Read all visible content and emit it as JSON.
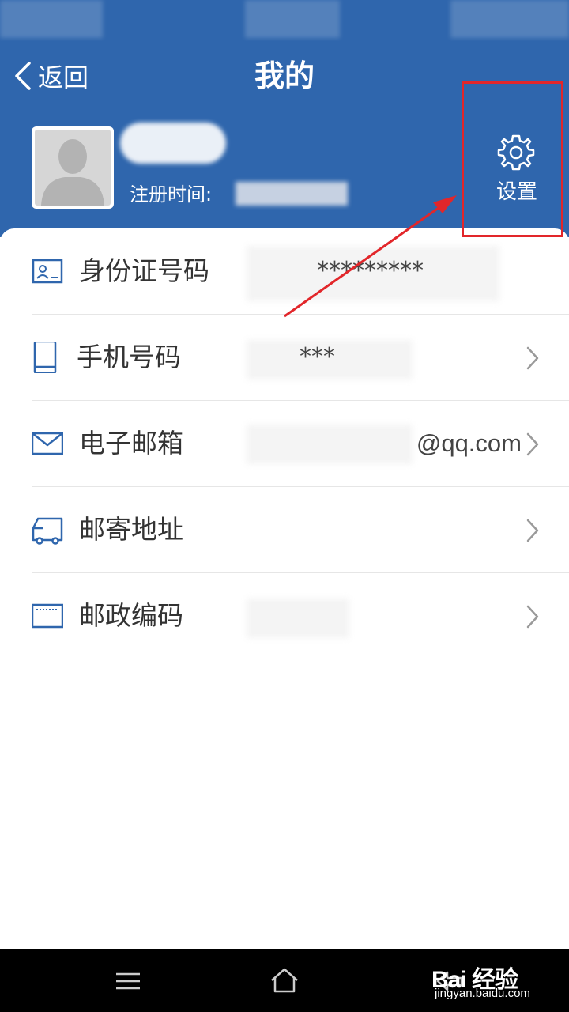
{
  "header": {
    "back_label": "返回",
    "title": "我的",
    "reg_time_label": "注册时间:",
    "settings_label": "设置"
  },
  "rows": [
    {
      "label": "身份证号码",
      "value": "*********",
      "icon": "id-card-icon",
      "has_chevron": false
    },
    {
      "label": "手机号码",
      "value": "***",
      "icon": "phone-icon",
      "has_chevron": true
    },
    {
      "label": "电子邮箱",
      "value": "@qq.com",
      "icon": "mail-icon",
      "has_chevron": true
    },
    {
      "label": "邮寄地址",
      "value": "",
      "icon": "truck-icon",
      "has_chevron": true
    },
    {
      "label": "邮政编码",
      "value": "",
      "icon": "keyboard-icon",
      "has_chevron": true
    }
  ],
  "nav": {
    "items": [
      "menu-icon",
      "home-icon",
      "back-icon"
    ]
  },
  "watermark": {
    "logo": "Bai 经验",
    "url": "jingyan.baidu.com"
  },
  "colors": {
    "header_bg": "#2f66ad",
    "icon_blue": "#2f66ad",
    "annotation_red": "#e2262a"
  }
}
